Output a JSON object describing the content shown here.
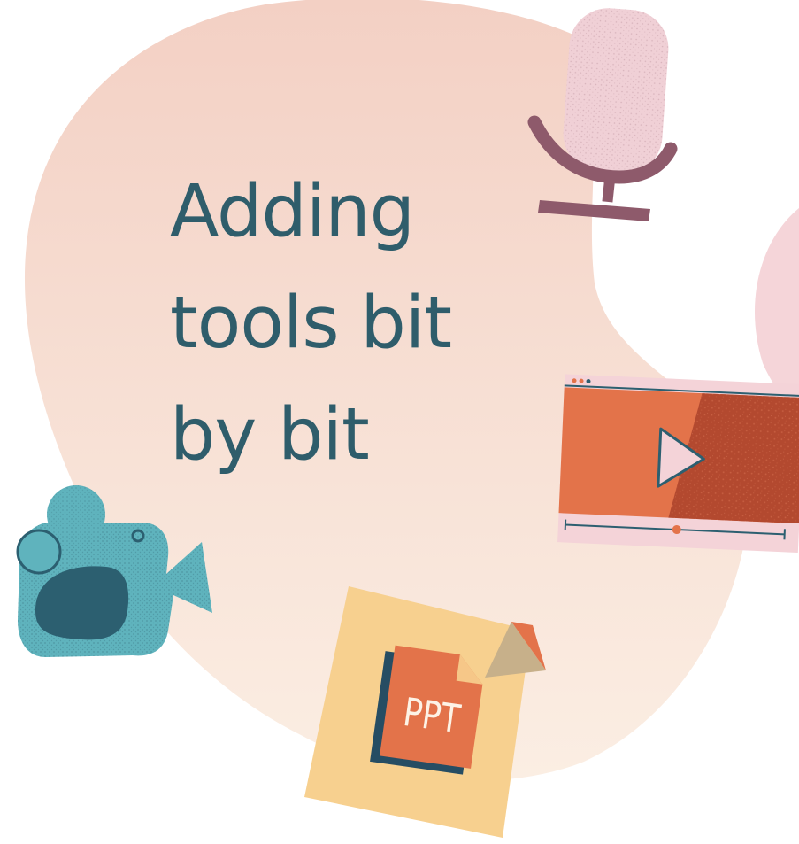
{
  "headline": {
    "line1": "Adding",
    "line2": "tools bit",
    "line3": "by bit"
  },
  "icons": {
    "microphone": "microphone-icon",
    "video_player": "video-player-icon",
    "video_camera": "video-camera-icon",
    "ppt_file": "ppt-file-icon"
  },
  "ppt_file": {
    "label": "PPT"
  },
  "colors": {
    "blob_top": "#f3d0c4",
    "blob_bottom": "#fbeee3",
    "headline_text": "#2f5d6b",
    "mic_body": "#f0d0d6",
    "mic_stand": "#8e5a6b",
    "player_left": "#e3734a",
    "player_right": "#b3492f",
    "player_bar": "#f4d3d8",
    "camera_teal": "#5fb3bd",
    "camera_dark": "#2c5f70",
    "note_paper": "#f7d08f",
    "ppt_orange": "#e3734a",
    "ppt_navy": "#264d63"
  }
}
